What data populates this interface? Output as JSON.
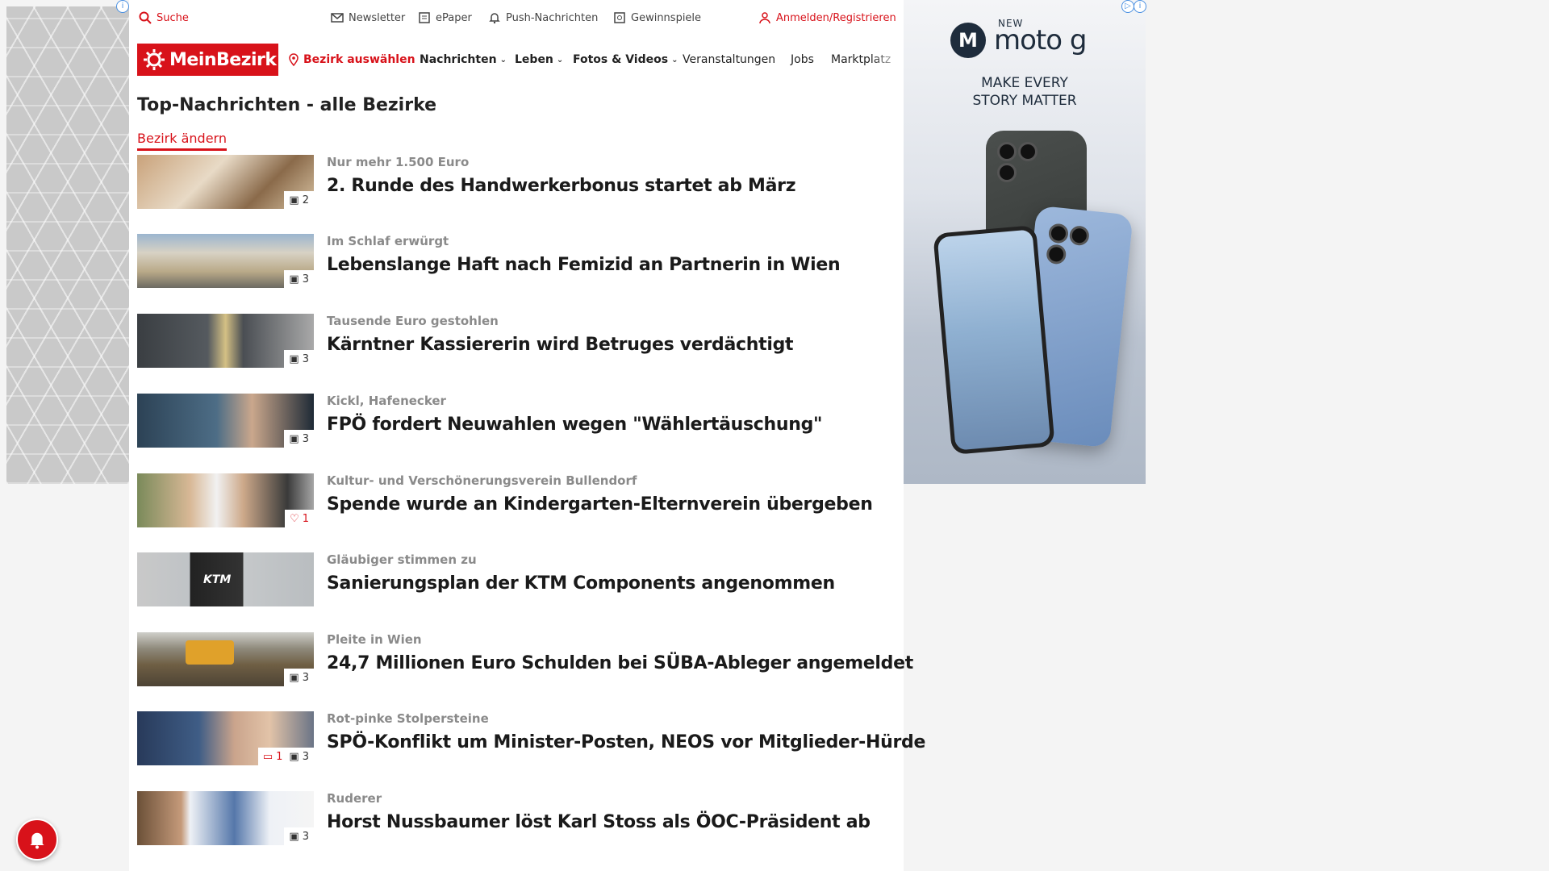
{
  "topbar": {
    "search": "Suche",
    "newsletter": "Newsletter",
    "epaper": "ePaper",
    "push": "Push-Nachrichten",
    "gewinnspiele": "Gewinnspiele",
    "login": "Anmelden/Registrieren"
  },
  "nav": {
    "logo": "MeinBezirk",
    "bezirk": "Bezirk auswählen",
    "items": [
      "Nachrichten",
      "Leben",
      "Fotos & Videos",
      "Veranstaltungen",
      "Jobs",
      "Marktplatz"
    ]
  },
  "page": {
    "title": "Top-Nachrichten - alle Bezirke",
    "change_link": "Bezirk ändern"
  },
  "articles": [
    {
      "kicker": "Nur mehr 1.500 Euro",
      "headline": "2. Runde des Handwerkerbonus startet ab März",
      "photos": "2"
    },
    {
      "kicker": "Im Schlaf erwürgt",
      "headline": "Lebenslange Haft nach Femizid an Partnerin in Wien",
      "photos": "3"
    },
    {
      "kicker": "Tausende Euro gestohlen",
      "headline": "Kärntner Kassiererin wird Betruges verdächtigt",
      "photos": "3"
    },
    {
      "kicker": "Kickl, Hafenecker",
      "headline": "FPÖ fordert Neuwahlen wegen \"Wählertäuschung\"",
      "photos": "3"
    },
    {
      "kicker": "Kultur- und Verschönerungsverein Bullendorf",
      "headline": "Spende wurde an Kindergarten-Elternverein übergeben",
      "likes": "1"
    },
    {
      "kicker": "Gläubiger stimmen zu",
      "headline": "Sanierungsplan der KTM Components angenommen"
    },
    {
      "kicker": "Pleite in Wien",
      "headline": "24,7 Millionen Euro Schulden bei SÜBA-Ableger angemeldet",
      "photos": "3"
    },
    {
      "kicker": "Rot-pinke Stolpersteine",
      "headline": "SPÖ-Konflikt um Minister-Posten, NEOS vor Mitglieder-Hürde",
      "comments": "1",
      "photos": "3"
    },
    {
      "kicker": "Ruderer",
      "headline": "Horst Nussbaumer löst Karl Stoss als ÖOC-Präsident ab",
      "photos": "3"
    }
  ],
  "ad": {
    "new": "NEW",
    "brand": "moto g",
    "tagline_1": "MAKE EVERY",
    "tagline_2": "STORY MATTER"
  },
  "colors": {
    "brand_red": "#d8121a"
  }
}
